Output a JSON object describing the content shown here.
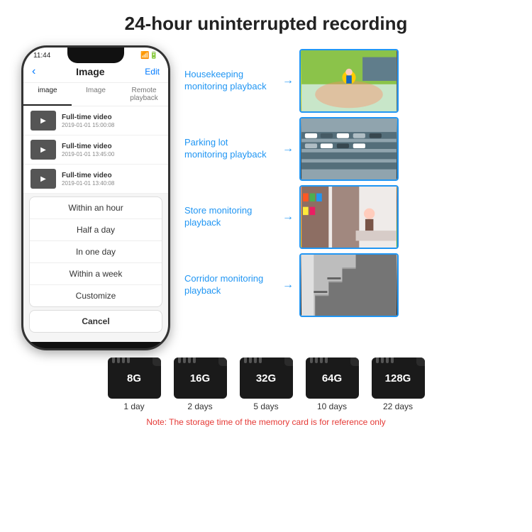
{
  "header": {
    "title": "24-hour uninterrupted recording"
  },
  "phone": {
    "status_time": "11:44",
    "nav_back": "‹",
    "nav_title": "Image",
    "nav_edit": "Edit",
    "tabs": [
      "image",
      "Image",
      "Remote playback"
    ],
    "active_tab_index": 0,
    "video_items": [
      {
        "title": "Full-time video",
        "date": "2019-01-01 15:00:08"
      },
      {
        "title": "Full-time video",
        "date": "2019-01-01 13:45:00"
      },
      {
        "title": "Full-time video",
        "date": "2019-01-01 13:40:08"
      }
    ],
    "dropdown_items": [
      "Within an hour",
      "Half a day",
      "In one day",
      "Within a week",
      "Customize"
    ],
    "cancel_label": "Cancel"
  },
  "scenes": [
    {
      "label": "Housekeeping monitoring playback",
      "img_class": "scene-img-child"
    },
    {
      "label": "Parking lot monitoring playback",
      "img_class": "scene-img-parking"
    },
    {
      "label": "Store monitoring playback",
      "img_class": "scene-img-store"
    },
    {
      "label": "Corridor monitoring playback",
      "img_class": "scene-img-corridor"
    }
  ],
  "sdcards": [
    {
      "size": "8G",
      "days": "1 day"
    },
    {
      "size": "16G",
      "days": "2 days"
    },
    {
      "size": "32G",
      "days": "5 days"
    },
    {
      "size": "64G",
      "days": "10 days"
    },
    {
      "size": "128G",
      "days": "22 days"
    }
  ],
  "note": "Note: The storage time of the memory card is for reference only",
  "colors": {
    "accent_blue": "#2196F3",
    "text_dark": "#222222",
    "note_red": "#e53935"
  }
}
